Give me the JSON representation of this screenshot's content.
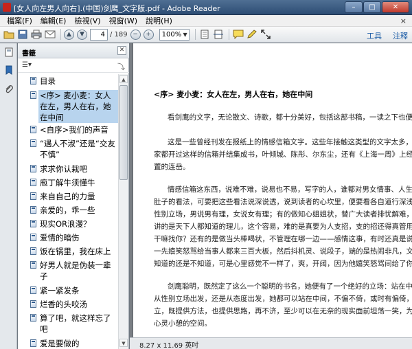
{
  "window": {
    "title": "[女人向左男人向右].(中国)剑鹰_文字版.pdf - Adobe Reader",
    "min_label": "–",
    "max_label": "□",
    "close_label": "✕"
  },
  "menu": {
    "items": [
      "檔案(F)",
      "編輯(E)",
      "檢視(V)",
      "視窗(W)",
      "說明(H)"
    ],
    "close_x": "×"
  },
  "toolbar": {
    "page_current": "4",
    "page_total": "/ 189",
    "zoom": "100%",
    "tools_link": "工具",
    "comment_link": "注釋"
  },
  "panel": {
    "title": "書籤",
    "bookmarks": [
      "目录",
      "<序> 麦小麦：女人在左，男人在右，她在中间",
      "<自序>我们的声音",
      "“遇人不淑”还是“交友不慎”",
      "求求你认栽吧",
      "庖丁解牛须懂牛",
      "来自自己的力量",
      "亲爱的，乖一些",
      "现实OR浪漫？",
      "爱情的暗伤",
      "饭在锅里，我在床上",
      "好男人就是伪装一辈子",
      "紧一紧发条",
      "烂香的头咬汤",
      "算了吧，就这样忘了吧",
      "爱是要做的"
    ]
  },
  "document": {
    "heading": "<序> 麦小麦：女人在左，男人在右，她在中间",
    "paragraphs": [
      "看剑鹰的文字，无论散文、诗歌，都十分美好，包括这部书稿，一读之下也便喜欢",
      "这是一些曾经刊发在报纸上的情感信箱文字。这些年接触这类型的文字太多，很多",
      "家都开过这样的信箱并结集成书，叶倾城、陈彤、尔东尘，还有《上海一周》上经年占据",
      "置的连岳。",
      "情感信箱这东西，说难不难，说易也不易，写字的人，谁都对男女情事、人生种种",
      "肚子的看法，可要把这些看法说深说透，说到读者的心坎里，便要看各自道行深浅了。有",
      "性别立场，男说男有理，女说女有理；有的做知心姐姐状，替广大读者排忧解难，说的是大",
      "讲的是天下人都知道的理儿，这个容易，难的是真要为人支招，支的招还得真管用，不然",
      "干嘛找你？还有的是做当头棒喝状，不管理在哪一边——感情这事，有时还真是说不清的",
      "一先嬉笑怒骂给当事人都来三百大板，然后抖机灵、说段子，端的是热闹非凡，文章有趣",
      "知道的还是不知道，可是心里感觉不一样了，爽，开阔，因为他嬉笑怒骂间给了你一种",
      "剑鹰聪明，既然定了这么一个聪明的书名，她便有了一个绝好的立场：站在中间。所",
      "从性别立场出发，还是从态度出发，她都可以站在中间，不偏不倚，或时有偏倚，都可以",
      "立，既提供方法，也提供思路，再不济，至少可以在无奈的现实面前坦荡一笑，为读者找",
      "心灵小憩的空间。"
    ]
  },
  "status": {
    "page_size": "8.27 x 11.69 英吋"
  }
}
